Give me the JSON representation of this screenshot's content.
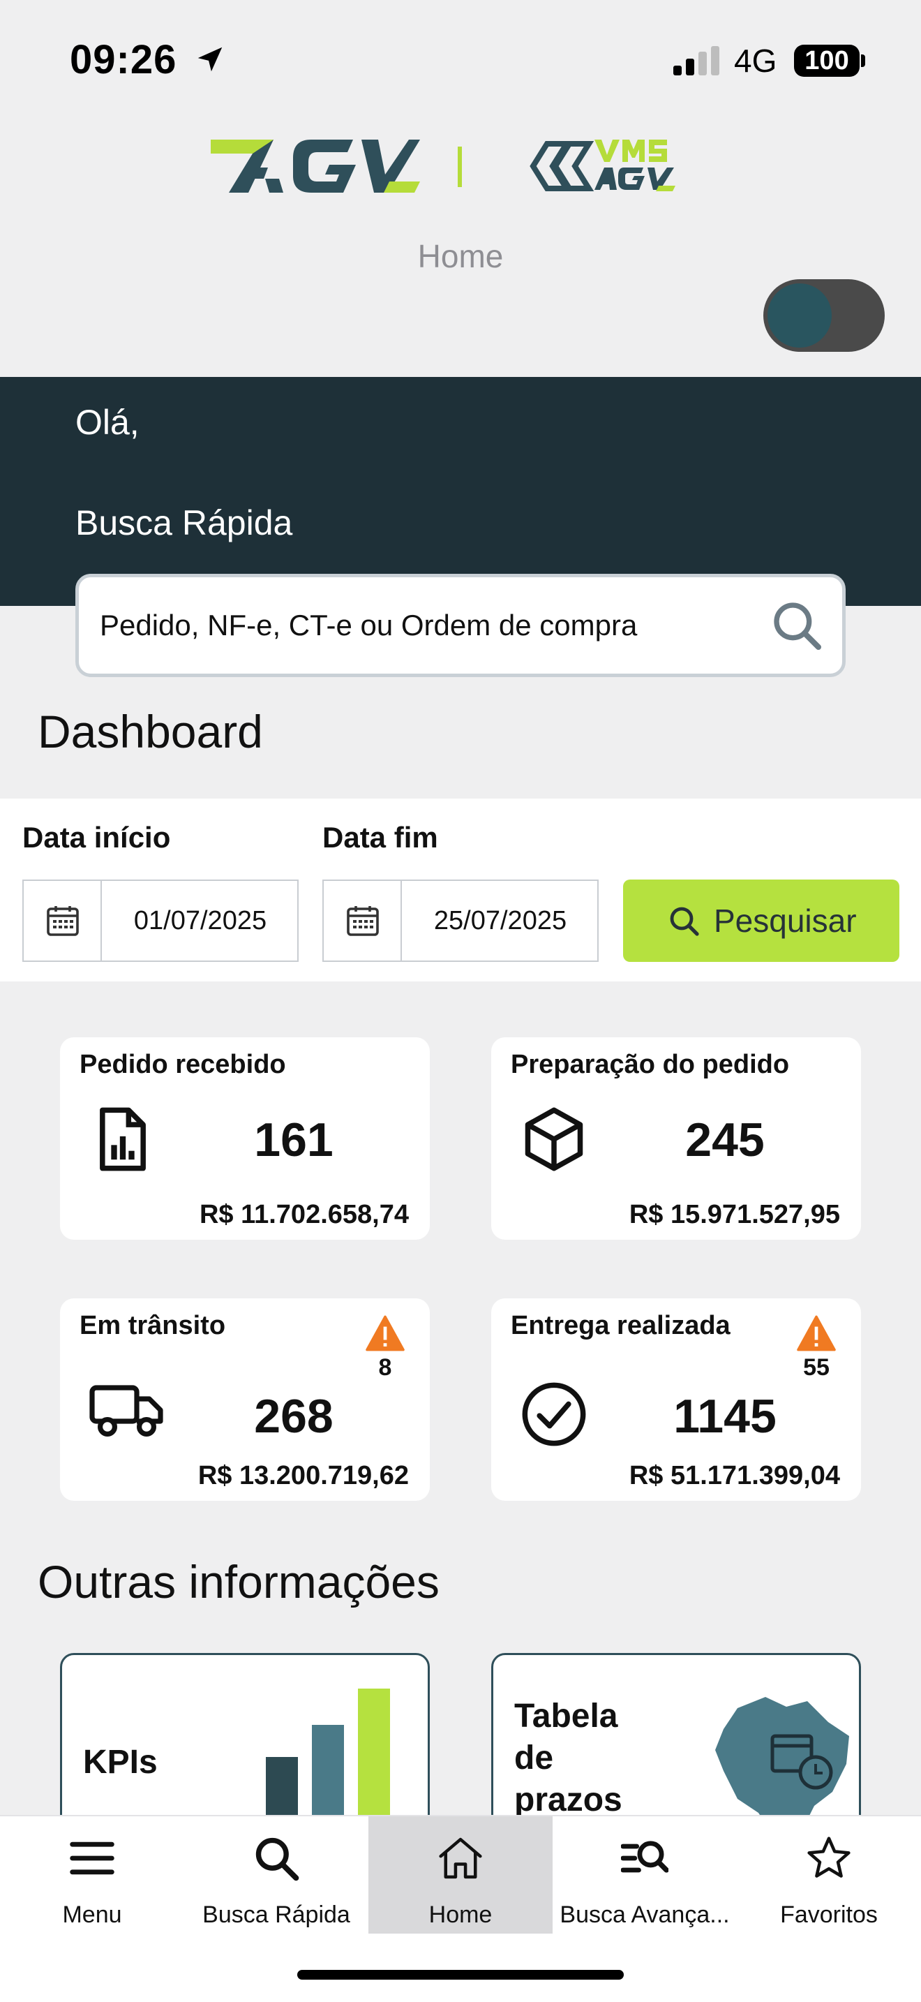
{
  "status_bar": {
    "time": "09:26",
    "network": "4G",
    "battery": "100"
  },
  "header": {
    "page_title": "Home"
  },
  "hero": {
    "greeting": "Olá,",
    "quick_search_label": "Busca Rápida"
  },
  "search": {
    "placeholder": "Pedido, NF-e, CT-e ou Ordem de compra"
  },
  "dashboard": {
    "title": "Dashboard",
    "start_label": "Data início",
    "end_label": "Data fim",
    "start_date": "01/07/2025",
    "end_date": "25/07/2025",
    "search_button": "Pesquisar",
    "cards": [
      {
        "title": "Pedido recebido",
        "count": "161",
        "amount": "R$ 11.702.658,74",
        "icon": "document-chart-icon"
      },
      {
        "title": "Preparação do pedido",
        "count": "245",
        "amount": "R$ 15.971.527,95",
        "icon": "box-icon"
      },
      {
        "title": "Em trânsito",
        "count": "268",
        "amount": "R$ 13.200.719,62",
        "icon": "truck-icon",
        "alert_count": "8"
      },
      {
        "title": "Entrega realizada",
        "count": "1145",
        "amount": "R$ 51.171.399,04",
        "icon": "check-circle-icon",
        "alert_count": "55"
      }
    ]
  },
  "other_info": {
    "title": "Outras informações",
    "cards": [
      {
        "title": "KPIs",
        "icon": "bar-chart-icon"
      },
      {
        "title_lines": [
          "Tabela",
          "de",
          "prazos"
        ],
        "icon": "brazil-map-calendar-icon"
      }
    ]
  },
  "nav": {
    "items": [
      {
        "label": "Menu",
        "icon": "hamburger-icon"
      },
      {
        "label": "Busca Rápida",
        "icon": "search-icon"
      },
      {
        "label": "Home",
        "icon": "home-icon",
        "active": true
      },
      {
        "label": "Busca Avança...",
        "icon": "advanced-search-icon"
      },
      {
        "label": "Favoritos",
        "icon": "star-icon"
      }
    ]
  },
  "colors": {
    "accent": "#b5e13f",
    "hero": "#1e3038",
    "teal": "#29555f",
    "alert": "#f07a22"
  }
}
